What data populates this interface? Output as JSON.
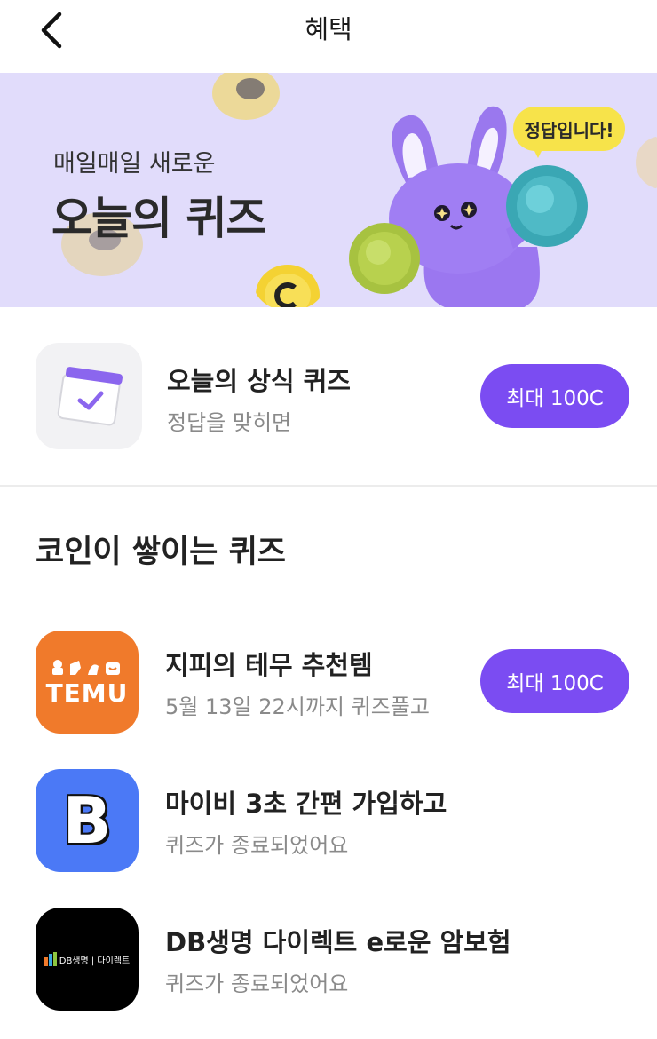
{
  "header": {
    "title": "혜택",
    "back_icon": "chevron-left-icon"
  },
  "banner": {
    "subtitle": "매일매일 새로운",
    "title": "오늘의 퀴즈",
    "bubble_text": "정답입니다!",
    "background_color": "#e1dcfb"
  },
  "today_quiz": {
    "title": "오늘의 상식 퀴즈",
    "subtitle": "정답을 맞히면",
    "button_label": "최대 100C",
    "icon": "calendar-check-icon"
  },
  "section": {
    "title": "코인이 쌓이는 퀴즈"
  },
  "quizzes": [
    {
      "title": "지피의 테무 추천템",
      "subtitle": "5월 13일 22시까지 퀴즈풀고",
      "button_label": "최대 100C",
      "logo_text": "TEMU",
      "logo_color": "#f07a2b"
    },
    {
      "title": "마이비 3초 간편 가입하고",
      "subtitle": "퀴즈가 종료되었어요",
      "logo_text": "B",
      "logo_color": "#4b79f6"
    },
    {
      "title": "DB생명 다이렉트 e로운 암보험",
      "subtitle": "퀴즈가 종료되었어요",
      "logo_text": "DB생명 | 다이렉트",
      "logo_color": "#000000"
    }
  ],
  "accent_color": "#7b4cf2"
}
